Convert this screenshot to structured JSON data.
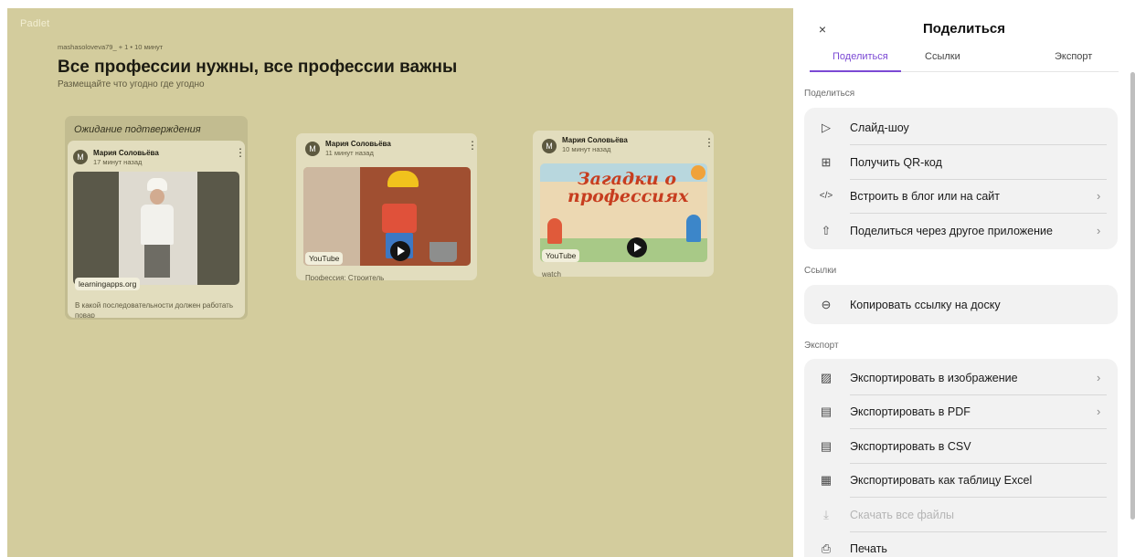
{
  "board": {
    "logo": "Padlet",
    "meta": "mashasoloveva79_ + 1 • 10 минут",
    "title": "Все профессии нужны, все профессии важны",
    "subtitle": "Размещайте что угодно где угодно",
    "pending_label": "Ожидание подтверждения",
    "cards": [
      {
        "avatar": "M",
        "author": "Мария Соловьёва",
        "time": "17 минут назад",
        "chip": "learningapps.org",
        "caption": "В какой последовательности должен работать повар"
      },
      {
        "avatar": "M",
        "author": "Мария Соловьёва",
        "time": "11 минут назад",
        "chip": "YouTube",
        "caption": "Профессия: Строитель"
      },
      {
        "avatar": "M",
        "author": "Мария Соловьёва",
        "time": "10 минут назад",
        "thumb_text": "Загадки о профессиях",
        "chip": "YouTube",
        "caption": "watch"
      }
    ]
  },
  "panel": {
    "close": "×",
    "title": "Поделиться",
    "tabs": [
      "Поделиться",
      "Ссылки",
      "Экспорт"
    ],
    "accent": "#7b49d4",
    "sections": [
      {
        "label": "Поделиться",
        "items": [
          {
            "icon": "▷",
            "label": "Слайд-шоу",
            "chevron": ""
          },
          {
            "icon": "⊞",
            "label": "Получить QR-код",
            "chevron": ""
          },
          {
            "icon": "</>",
            "label": "Встроить в блог или на сайт",
            "chevron": "›"
          },
          {
            "icon": "⇧",
            "label": "Поделиться через другое приложение",
            "chevron": "›"
          }
        ]
      },
      {
        "label": "Ссылки",
        "items": [
          {
            "icon": "⊖",
            "label": "Копировать ссылку на доску",
            "chevron": ""
          }
        ]
      },
      {
        "label": "Экспорт",
        "items": [
          {
            "icon": "▨",
            "label": "Экспортировать в изображение",
            "chevron": "›"
          },
          {
            "icon": "▤",
            "label": "Экспортировать в PDF",
            "chevron": "›"
          },
          {
            "icon": "▤",
            "label": "Экспортировать в CSV",
            "chevron": ""
          },
          {
            "icon": "▦",
            "label": "Экспортировать как таблицу Excel",
            "chevron": ""
          },
          {
            "icon": "⤓",
            "label": "Скачать все файлы",
            "chevron": ""
          },
          {
            "icon": "⎙",
            "label": "Печать",
            "chevron": ""
          }
        ]
      }
    ]
  }
}
